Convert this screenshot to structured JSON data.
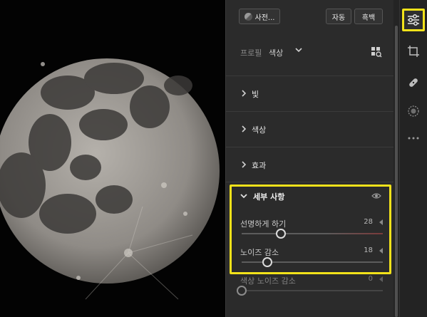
{
  "top_bar": {
    "presets_label": "사전...",
    "auto_label": "자동",
    "bw_label": "흑백"
  },
  "profile": {
    "label": "프로필",
    "value": "색상"
  },
  "sections": [
    {
      "title": "빛"
    },
    {
      "title": "색상"
    },
    {
      "title": "효과"
    }
  ],
  "detail": {
    "title": "세부 사항",
    "sliders": [
      {
        "label": "선명하게 하기",
        "value": "28",
        "level": 0.28
      },
      {
        "label": "노이즈 감소",
        "value": "18",
        "level": 0.18
      },
      {
        "label": "색상 노이즈 감소",
        "value": "0",
        "level": 0.0
      }
    ]
  },
  "colors": {
    "highlight": "#f2e21a",
    "panel_bg": "#2b2b2b",
    "photo_bg": "#030303"
  },
  "rail": {
    "icons": [
      "sliders-icon",
      "crop-icon",
      "bandage-icon",
      "masking-icon",
      "more-icon"
    ]
  }
}
